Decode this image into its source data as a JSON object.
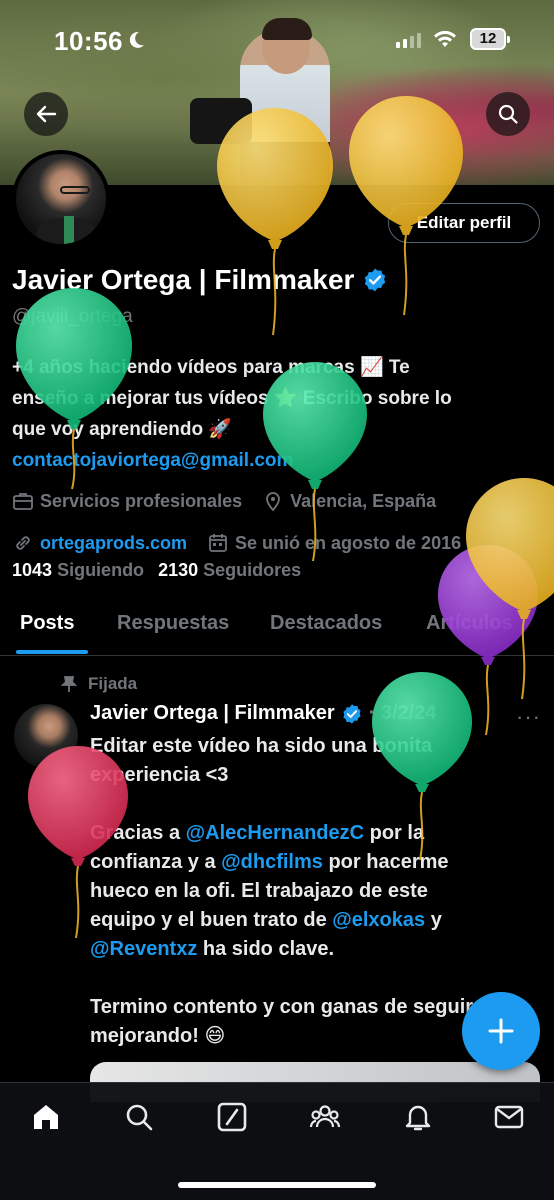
{
  "status_bar": {
    "time": "10:56",
    "battery": "12"
  },
  "profile": {
    "name": "Javier Ortega | Filmmaker",
    "handle": "@javiii_ortega",
    "edit_button": "Editar perfil",
    "bio_lines": [
      "+4 años haciendo vídeos para marcas 📈 Te",
      "enseño a mejorar tus vídeos ⭐ Escribo sobre lo",
      "que voy aprendiendo 🚀"
    ],
    "email": "contactojaviortega@gmail.com",
    "category": "Servicios profesionales",
    "location": "Valencia, España",
    "website": "ortegaprods.com",
    "joined": "Se unió en agosto de 2016",
    "following_count": "1043",
    "following_label": "Siguiendo",
    "followers_count": "2130",
    "followers_label": "Seguidores"
  },
  "tabs": [
    "Posts",
    "Respuestas",
    "Destacados",
    "Artículos"
  ],
  "post": {
    "pinned_label": "Fijada",
    "author": "Javier Ortega | Filmmaker",
    "date": "· 3/2/24",
    "more": "···",
    "lines": {
      "l1": "Editar este vídeo ha sido una bonita",
      "l2": "experiencia <3",
      "l3a": "Gracias a ",
      "l3b": "@AlecHernandezC",
      "l3c": " por la",
      "l4a": "confianza y a ",
      "l4b": "@dhcfilms",
      "l4c": " por hacerme",
      "l5": "hueco en la ofi. El trabajazo de este",
      "l6a": "equipo y el buen trato de ",
      "l6b": "@elxokas",
      "l6c": " y",
      "l7a": "@Reventxz",
      "l7b": " ha sido clave.",
      "l8": "Termino contento y con ganas de seguir",
      "l9": "mejorando! 😄"
    }
  },
  "icons": {
    "back": "back-arrow-icon",
    "search": "search-icon",
    "verified": "verified-badge-icon",
    "nav": [
      "home-icon",
      "search-icon",
      "grok-icon",
      "communities-icon",
      "notifications-icon",
      "messages-icon"
    ],
    "fab": "plus-icon"
  },
  "colors": {
    "accent": "#1d9bf0",
    "balloon_yellow": "#f2c12e",
    "balloon_green": "#22c987",
    "balloon_purple": "#9b3dd6",
    "balloon_red": "#e03a5f"
  }
}
